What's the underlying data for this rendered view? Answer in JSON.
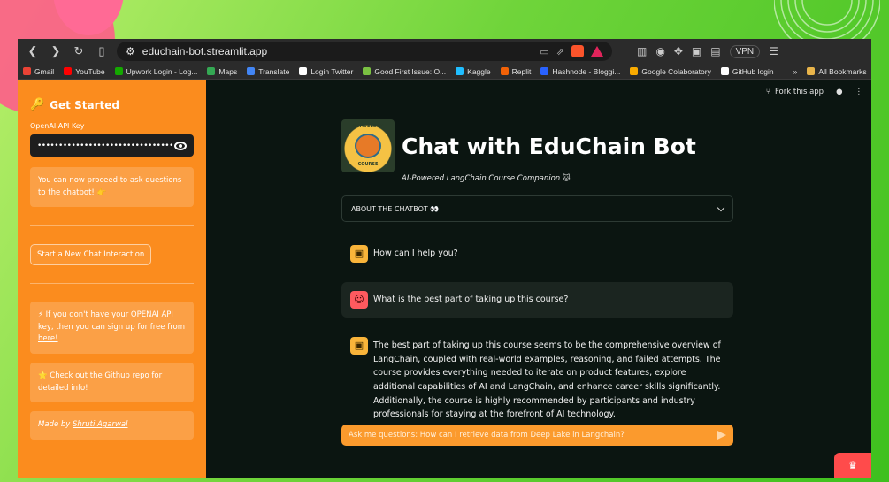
{
  "browser": {
    "url": "educhain-bot.streamlit.app",
    "vpn_label": "VPN",
    "bookmarks": [
      {
        "label": "Gmail",
        "color": "#ea4335"
      },
      {
        "label": "YouTube",
        "color": "#ff0000"
      },
      {
        "label": "Upwork Login - Log...",
        "color": "#14a800"
      },
      {
        "label": "Maps",
        "color": "#34a853"
      },
      {
        "label": "Translate",
        "color": "#4285f4"
      },
      {
        "label": "Login Twitter",
        "color": "#ffffff"
      },
      {
        "label": "Good First Issue: O...",
        "color": "#7ac142"
      },
      {
        "label": "Kaggle",
        "color": "#20beff"
      },
      {
        "label": "Replit",
        "color": "#f26207"
      },
      {
        "label": "Hashnode - Bloggi...",
        "color": "#2962ff"
      },
      {
        "label": "Google Colaboratory",
        "color": "#f9ab00"
      },
      {
        "label": "GitHub login",
        "color": "#ffffff"
      }
    ],
    "all_bookmarks": "All Bookmarks"
  },
  "sidebar": {
    "title": "Get Started",
    "api_label": "OpenAI API Key",
    "api_value": "••••••••••••••••••••••••••••••••••••••••••••••••••",
    "notice": "You can now proceed to ask questions to the chatbot! 👉",
    "new_chat_button": "Start a New Chat Interaction",
    "openai_info_prefix": "⚡ If you don't have your OPENAI API key, then you can sign up for free from ",
    "openai_info_link": "here!",
    "github_info_prefix": "⭐ Check out the ",
    "github_info_link": "Github repo",
    "github_info_suffix": " for detailed info!",
    "made_by_prefix": "Made by ",
    "made_by_link": "Shruti Agarwal"
  },
  "main": {
    "fork_label": "Fork this app",
    "logo_text_top": "ACTIVELOOP",
    "logo_text_bottom": "COURSE",
    "title": "Chat with EduChain Bot",
    "subtitle": "AI-Powered LangChain Course Companion 🐱",
    "expander_label": "ABOUT THE CHATBOT 👀",
    "messages": [
      {
        "role": "assistant",
        "text": "How can I help you?"
      },
      {
        "role": "user",
        "text": "What is the best part of taking up this course?"
      },
      {
        "role": "assistant",
        "text": "The best part of taking up this course seems to be the comprehensive overview of LangChain, coupled with real-world examples, reasoning, and failed attempts. The course provides everything needed to iterate on product features, explore additional capabilities of AI and LangChain, and enhance career skills significantly. Additionally, the course is highly recommended by participants and industry professionals for staying at the forefront of AI technology."
      }
    ],
    "input_placeholder": "Ask me questions: How can I retrieve data from Deep Lake in Langchain?"
  }
}
